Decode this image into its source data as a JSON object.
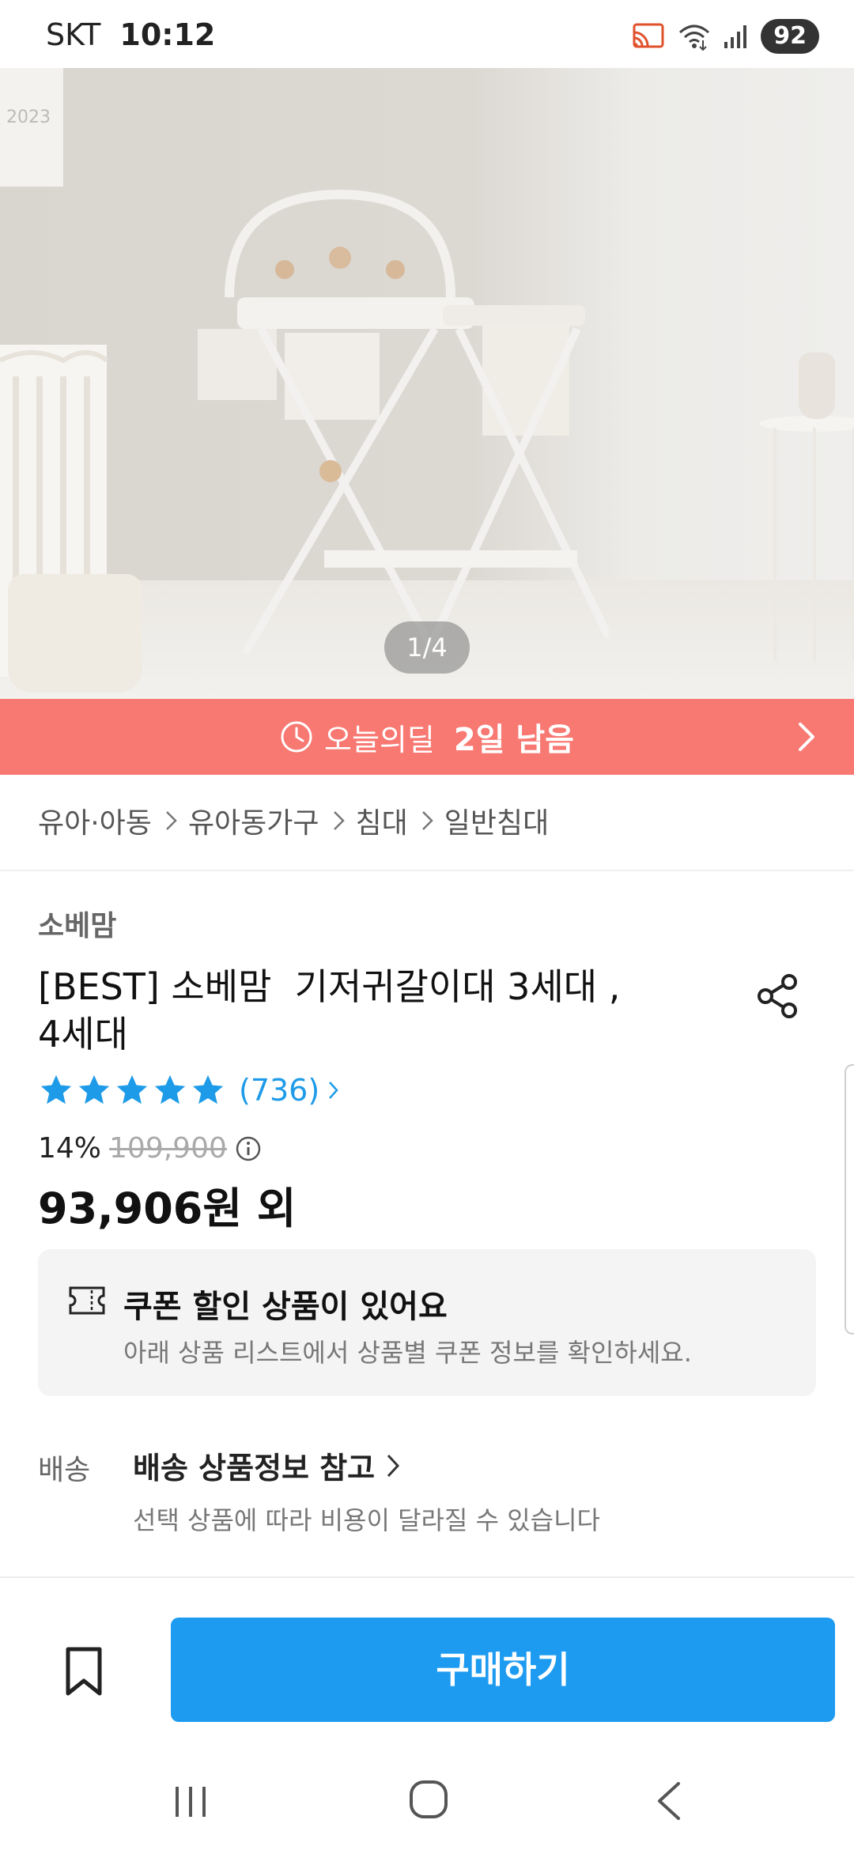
{
  "status_bar": {
    "carrier": "SKT",
    "time": "10:12",
    "battery": "92"
  },
  "gallery": {
    "calendar_text": "2023",
    "pager": "1/4"
  },
  "deal_bar": {
    "label": "오늘의딜",
    "remaining": "2일 남음"
  },
  "breadcrumb": [
    "유아·아동",
    "유아동가구",
    "침대",
    "일반침대"
  ],
  "product": {
    "brand": "소베맘",
    "title_line1": "[BEST] 소베맘  기저귀갈이대 3세대 ,",
    "title_line2": "4세대",
    "rating_count": "(736)",
    "rating_stars": 5,
    "discount": "14%",
    "original_price": "109,900",
    "price": "93,906원 외"
  },
  "coupon": {
    "title": "쿠폰 할인 상품이 있어요",
    "description": "아래 상품 리스트에서 상품별 쿠폰 정보를 확인하세요."
  },
  "shipping": {
    "label": "배송",
    "title": "배송 상품정보 참고",
    "description": "선택 상품에 따라 비용이 달라질 수 있습니다"
  },
  "bottom_bar": {
    "buy_label": "구매하기"
  },
  "colors": {
    "deal_bar": "#f87872",
    "accent_blue": "#1d9bf0",
    "star": "#1e9be8"
  }
}
